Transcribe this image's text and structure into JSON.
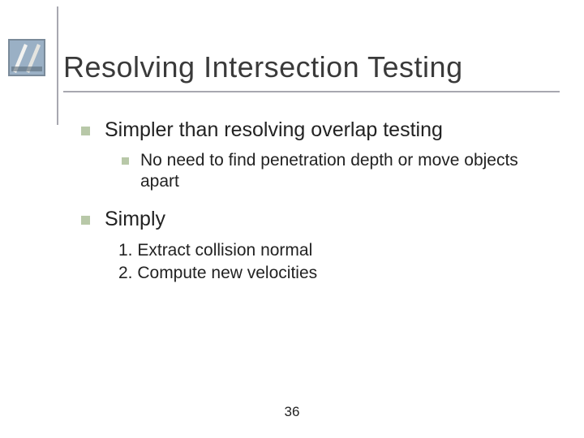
{
  "slide": {
    "title": "Resolving Intersection Testing",
    "page_number": "36"
  },
  "bullets": {
    "b1": "Simpler than resolving overlap testing",
    "b1_sub1": "No need to find penetration depth or move objects apart",
    "b2": "Simply"
  },
  "numbered": {
    "n1": "1. Extract collision normal",
    "n2": "2. Compute new velocities"
  },
  "colors": {
    "bullet": "#b8c8a8",
    "rule": "#a8a8b0"
  }
}
